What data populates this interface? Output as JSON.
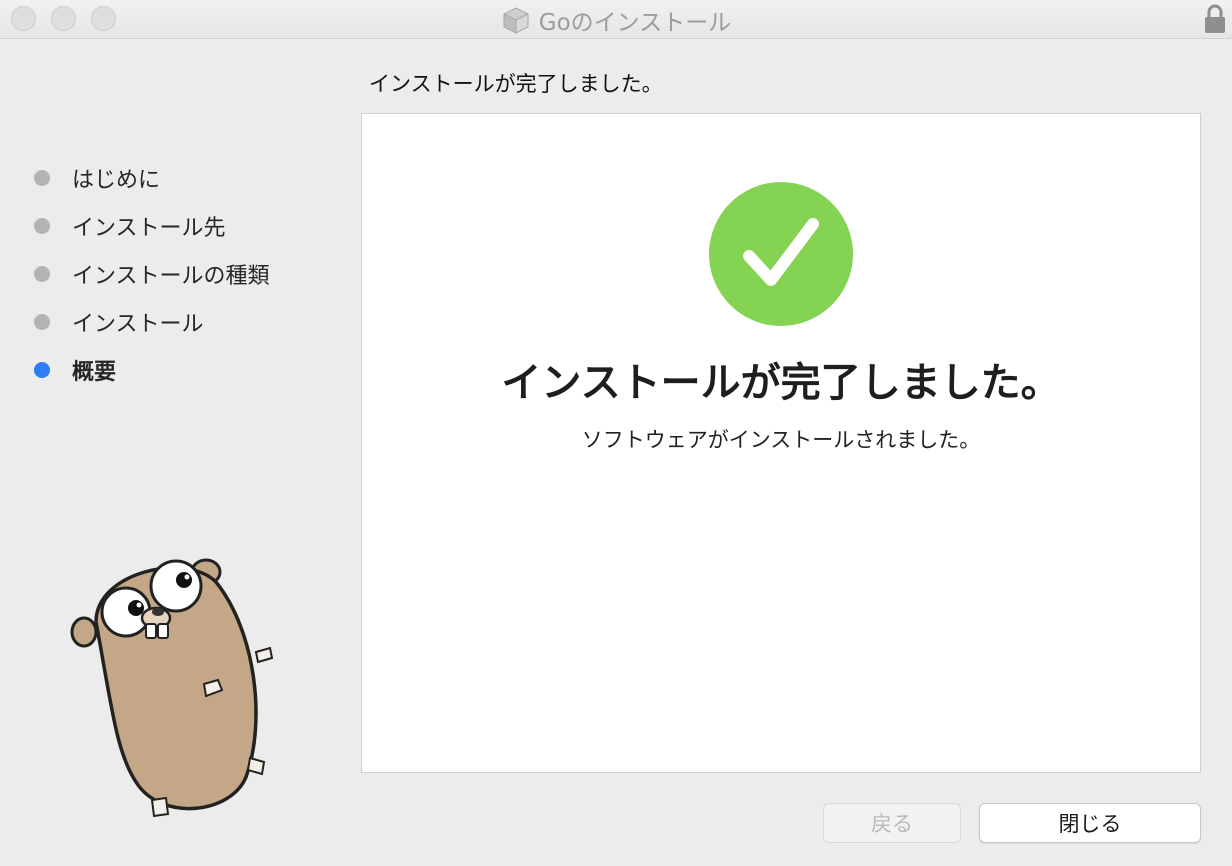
{
  "window": {
    "title": "Goのインストール",
    "title_icon": "package-icon",
    "lock_icon": "lock-icon"
  },
  "header": {
    "text": "インストールが完了しました。"
  },
  "steps": [
    {
      "label": "はじめに",
      "active": false
    },
    {
      "label": "インストール先",
      "active": false
    },
    {
      "label": "インストールの種類",
      "active": false
    },
    {
      "label": "インストール",
      "active": false
    },
    {
      "label": "概要",
      "active": true
    }
  ],
  "panel": {
    "icon": "checkmark-circle-icon",
    "title": "インストールが完了しました。",
    "subtitle": "ソフトウェアがインストールされました。"
  },
  "buttons": {
    "back_label": "戻る",
    "close_label": "閉じる"
  },
  "colors": {
    "accent": "#2f7cf6",
    "success": "#84d352",
    "gopher": "#c4a787"
  }
}
